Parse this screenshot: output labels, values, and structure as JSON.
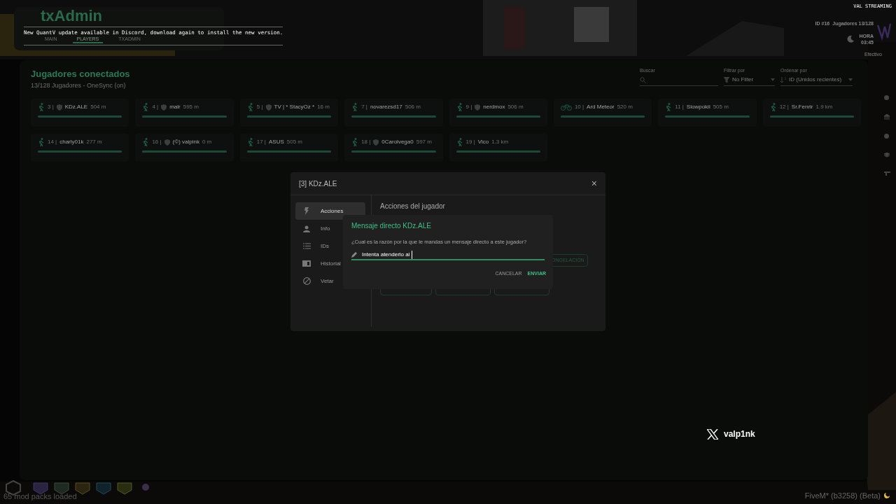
{
  "hud": {
    "streamer": "VAL STREAMING",
    "id": "ID #16",
    "players": "Jugadores 13/128",
    "time_label": "HORA",
    "time": "03:45",
    "cash_label": "Efectivo"
  },
  "notification": "New QuantV update available in Discord, download again to install the new version.",
  "txadmin": {
    "logo": "txAdmin",
    "tabs": [
      {
        "label": "MAIN",
        "selected": false
      },
      {
        "label": "PLAYERS",
        "selected": true
      },
      {
        "label": "TXADMIN",
        "selected": false
      }
    ]
  },
  "players_panel": {
    "title": "Jugadores conectados",
    "subtitle": "13/128 Jugadores - OneSync (on)",
    "search": {
      "label": "Buscar"
    },
    "filter": {
      "label": "Filtrar por",
      "value": "No Filter"
    },
    "sort": {
      "label": "Ordenar por",
      "value": "ID (Unidos recientes)"
    },
    "players": [
      {
        "kind": "walk",
        "admin": true,
        "id": "3 |",
        "name": "KDz.ALE",
        "distance": "504 m",
        "level": 1
      },
      {
        "kind": "walk",
        "admin": true,
        "id": "4 |",
        "name": "malr",
        "distance": "595 m",
        "level": 1
      },
      {
        "kind": "walk",
        "admin": true,
        "id": "5 |",
        "name": "TV | * StacyOz *",
        "distance": "16 m",
        "level": 1
      },
      {
        "kind": "walk",
        "admin": false,
        "id": "7 |",
        "name": "novarezsd17",
        "distance": "506 m",
        "level": 1
      },
      {
        "kind": "walk",
        "admin": true,
        "id": "9 |",
        "name": "nerdmox",
        "distance": "506 m",
        "level": 1
      },
      {
        "kind": "bike",
        "admin": false,
        "id": "10 |",
        "name": "Ard Meteor",
        "distance": "520 m",
        "level": 1
      },
      {
        "kind": "walk",
        "admin": false,
        "id": "11 |",
        "name": "Slowpokii",
        "distance": "505 m",
        "level": 1
      },
      {
        "kind": "walk",
        "admin": false,
        "id": "12 |",
        "name": "Sr.Fenrir",
        "distance": "1.9 km",
        "level": 1
      },
      {
        "kind": "walk",
        "admin": false,
        "id": "14 |",
        "name": "charly01k",
        "distance": "277 m",
        "level": 1
      },
      {
        "kind": "walk",
        "admin": true,
        "id": "16 |",
        "name": "(©) valpink",
        "distance": "0 m",
        "level": 1
      },
      {
        "kind": "walk",
        "admin": false,
        "id": "17 |",
        "name": "ASUS",
        "distance": "505 m",
        "level": 1
      },
      {
        "kind": "walk",
        "admin": true,
        "id": "18 |",
        "name": "0Carolvega0",
        "distance": "597 m",
        "level": 1
      },
      {
        "kind": "walk",
        "admin": false,
        "id": "19 |",
        "name": "Vico",
        "distance": "1.3 km",
        "level": 1
      }
    ]
  },
  "modal": {
    "title": "[3] KDz.ALE",
    "close": "×",
    "heading": "Acciones del jugador",
    "partial_action": "ONGELACIÓN",
    "menu": [
      {
        "kind": "bolt",
        "label": "Acciones",
        "selected": true
      },
      {
        "kind": "person",
        "label": "Info",
        "selected": false
      },
      {
        "kind": "list",
        "label": "IDs",
        "selected": false
      },
      {
        "kind": "book",
        "label": "Historial",
        "selected": false
      },
      {
        "kind": "ban",
        "label": "Vetar",
        "selected": false
      }
    ]
  },
  "message_dialog": {
    "title": "Mensaje directo KDz.ALE",
    "question": "¿Cual es la razón por la que le mandas un mensaje directo a este jugador?",
    "value": "Intenta atenderlo al",
    "buttons": [
      {
        "label": "CANCELAR",
        "primary": false
      },
      {
        "label": "ENVIAR",
        "primary": true
      }
    ]
  },
  "social": {
    "handle": "valp1nk"
  },
  "footer": {
    "mod_packs": "65 mod packs loaded",
    "build": "FiveM* (b3258) (Beta)"
  }
}
